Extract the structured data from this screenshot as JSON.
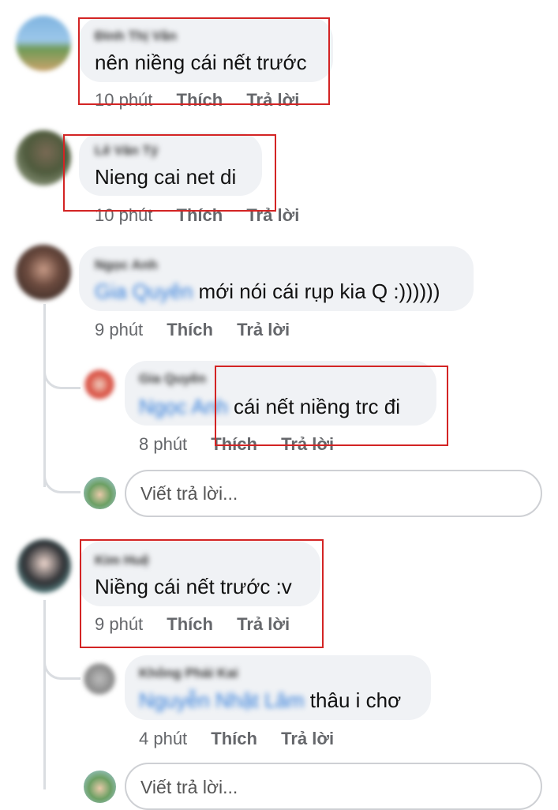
{
  "comments": [
    {
      "author": "Đinh Thị Vân",
      "text": "nên niềng cái nết trước",
      "time": "10 phút",
      "like": "Thích",
      "reply": "Trả lời"
    },
    {
      "author": "Lê Văn Tý",
      "text": "Nieng cai net di",
      "time": "10 phút",
      "like": "Thích",
      "reply": "Trả lời"
    },
    {
      "author": "Ngọc Anh",
      "mention": "Gia Quyên",
      "text": "mới nói cái rụp kia Q :))))))",
      "time": "9 phút",
      "like": "Thích",
      "reply": "Trả lời",
      "replies": [
        {
          "author": "Gia Quyên",
          "mention": "Ngọc Anh",
          "text": "cái nết niềng trc đi",
          "time": "8 phút",
          "like": "Thích",
          "reply": "Trả lời"
        }
      ],
      "reply_placeholder": "Viết trả lời..."
    },
    {
      "author": "Kim Huệ",
      "text": "Niềng cái nết trước :v",
      "time": "9 phút",
      "like": "Thích",
      "reply": "Trả lời",
      "replies": [
        {
          "author": "Không Phải Kai",
          "mention": "Nguyễn Nhật Lâm",
          "text": "thâu i chơ",
          "time": "4 phút",
          "like": "Thích",
          "reply": "Trả lời"
        }
      ],
      "reply_placeholder": "Viết trả lời..."
    }
  ],
  "colors": {
    "bubble": "#f0f2f5",
    "highlight_box": "#d32424",
    "mention": "#2d7ad9",
    "meta_text": "#65676b"
  }
}
